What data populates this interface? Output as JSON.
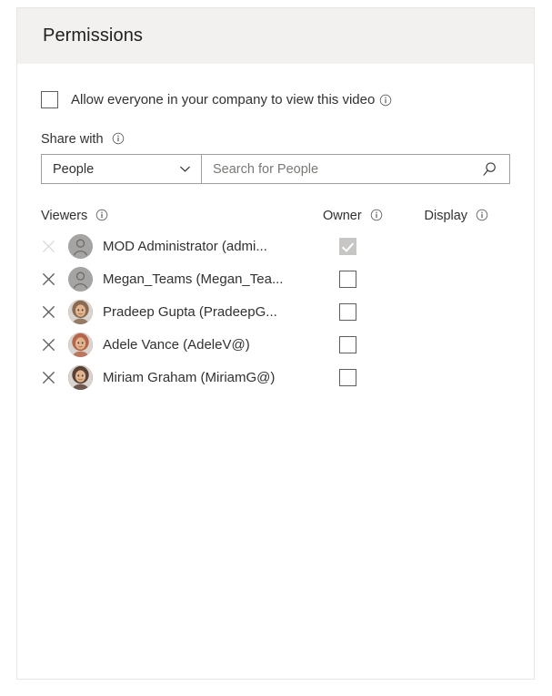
{
  "panel": {
    "title": "Permissions"
  },
  "allow_everyone": {
    "label": "Allow everyone in your company to view this video",
    "checked": false,
    "info_icon": "info-icon"
  },
  "share_with": {
    "label": "Share with",
    "info_icon": "info-icon",
    "dropdown": {
      "selected": "People",
      "chevron_icon": "chevron-down-icon",
      "options": [
        "People"
      ]
    },
    "search": {
      "value": "",
      "placeholder": "Search for People",
      "icon": "search-icon"
    }
  },
  "table": {
    "headers": {
      "viewers": "Viewers",
      "owner": "Owner",
      "display": "Display",
      "info_icon": "info-icon"
    },
    "rows": [
      {
        "name": "MOD Administrator (admi...",
        "avatar_type": "person-glyph",
        "avatar_color": "#a6a4a2",
        "owner_checked": true,
        "owner_disabled": true,
        "remove_icon": "close-icon",
        "remove_disabled": true
      },
      {
        "name": "Megan_Teams (Megan_Tea...",
        "avatar_type": "person-glyph",
        "avatar_color": "#a6a4a2",
        "owner_checked": false,
        "owner_disabled": false,
        "remove_icon": "close-icon",
        "remove_disabled": false
      },
      {
        "name": "Pradeep Gupta (PradeepG...",
        "avatar_type": "photo",
        "avatar_color": "#8a6b52",
        "owner_checked": false,
        "owner_disabled": false,
        "remove_icon": "close-icon",
        "remove_disabled": false
      },
      {
        "name": "Adele Vance (AdeleV@)",
        "avatar_type": "photo",
        "avatar_color": "#b5654a",
        "owner_checked": false,
        "owner_disabled": false,
        "remove_icon": "close-icon",
        "remove_disabled": false
      },
      {
        "name": "Miriam Graham (MiriamG@)",
        "avatar_type": "photo",
        "avatar_color": "#5a4237",
        "owner_checked": false,
        "owner_disabled": false,
        "remove_icon": "close-icon",
        "remove_disabled": false
      }
    ]
  },
  "colors": {
    "header_band": "#f2f1f0",
    "panel_border": "#e6e6e6",
    "text": "#323130",
    "control_border": "#a19f9d",
    "checkbox_border": "#605e5c",
    "disabled_fill": "#c8c6c4"
  }
}
